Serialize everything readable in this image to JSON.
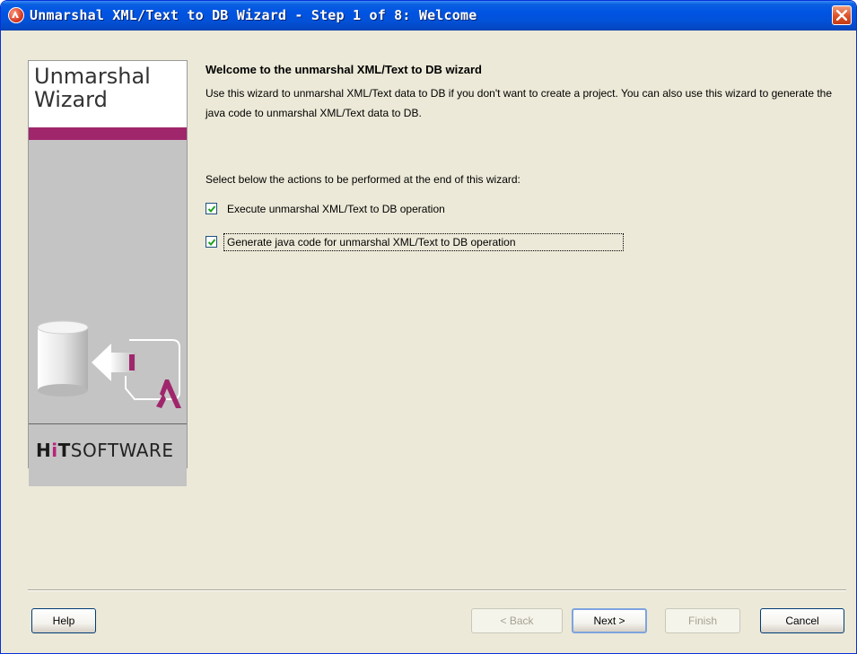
{
  "window": {
    "title": "Unmarshal XML/Text to DB Wizard - Step 1 of 8: Welcome"
  },
  "banner": {
    "title": "Unmarshal\nWizard",
    "logo_hit": "HiT",
    "logo_software": "SOFTWARE"
  },
  "content": {
    "heading": "Welcome to the unmarshal XML/Text to DB wizard",
    "description": "Use this wizard to unmarshal XML/Text data to DB if you don't want to create a project. You can also use this wizard to generate the java code to unmarshal XML/Text data to DB.",
    "select_label": "Select below the actions to be performed at the end of this wizard:",
    "options": [
      {
        "label": "Execute unmarshal XML/Text to DB operation",
        "checked": true
      },
      {
        "label": "Generate java code for unmarshal XML/Text to DB operation",
        "checked": true
      }
    ]
  },
  "buttons": {
    "help": "Help",
    "back": "< Back",
    "next": "Next >",
    "finish": "Finish",
    "cancel": "Cancel"
  },
  "colors": {
    "titlebar": "#0054e3",
    "banner_accent": "#a0266c",
    "dialog_bg": "#ece9d8"
  }
}
